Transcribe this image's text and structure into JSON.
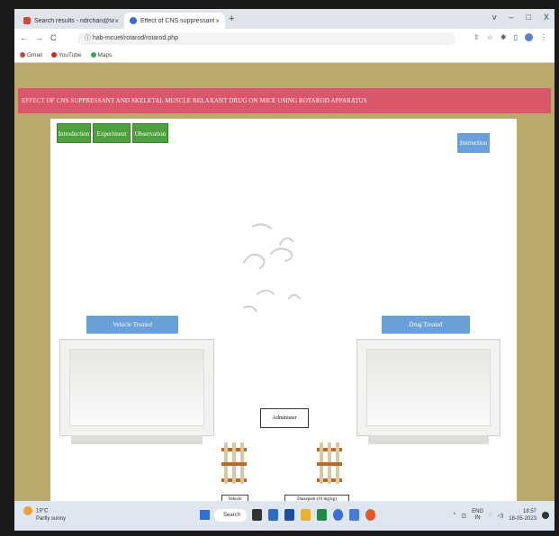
{
  "browser": {
    "tabs": [
      {
        "label": "Search results - ndrchan@silveroa",
        "active": false
      },
      {
        "label": "Effect of CNS suppressant and r",
        "active": true
      }
    ],
    "new_tab": "+",
    "url": "hab-mcuet/rotarod/rotarod.php",
    "window_controls": [
      "v",
      "–",
      "□",
      "X"
    ],
    "bookmarks": [
      "Gmail",
      "YouTube",
      "Maps"
    ]
  },
  "page": {
    "banner_title": "EFFECT OF CNS SUPPRESSANT AND SKELETAL MUSCLE RELAXANT DRUG ON MICE USING ROTAROD APPARATUS",
    "nav_buttons": [
      "Introduction",
      "Experiment",
      "Observation"
    ],
    "instruction_button": "Instruction",
    "vehicle_label": "Vehicle Treated",
    "drug_label": "Drug Treated",
    "administer_button": "Administer",
    "vehicle_tube_label": "Vehicle",
    "drug_tube_label": "Diazepam (10 mg/kg)"
  },
  "taskbar": {
    "weather_temp": "19°C",
    "weather_desc": "Partly sunny",
    "search_label": "Search",
    "lang": "ENG",
    "lang_sub": "IN",
    "time": "18:57",
    "date": "18-05-2023"
  },
  "colors": {
    "banner": "#d9566b",
    "nav_green": "#4e9f3d",
    "label_blue": "#6aa0d8",
    "page_bg": "#b9a96a"
  }
}
